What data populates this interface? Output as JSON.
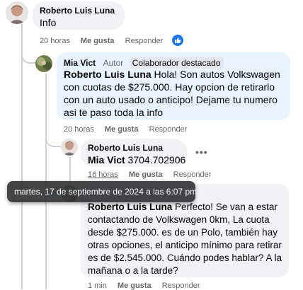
{
  "comments": [
    {
      "author": "Roberto Luis Luna",
      "text": "Info",
      "time": "20 horas",
      "like_label": "Me gusta",
      "reply_label": "Responder"
    },
    {
      "author": "Mia Vict",
      "author_badge": "Autor",
      "collab_badge": "Colaborador destacado",
      "mention": "Roberto Luis Luna",
      "text": " Hola! Son autos Volkswagen con cuotas de $275.000. Hay opcion de retirarlo con un auto usado o anticipo! Dejame tu numero asi te paso toda la info",
      "time": "20 horas",
      "like_label": "Me gusta",
      "reply_label": "Responder"
    },
    {
      "author": "Roberto Luis Luna",
      "mention": "Mia Vict",
      "text": " 3704.702906",
      "time": "16 horas",
      "like_label": "Me gusta",
      "reply_label": "Responder"
    },
    {
      "mention": "Roberto Luis Luna",
      "text": " Perfecto! Se van a estar contactando de Volkswagen 0km, La cuota desde $275.000. es de un Polo, también hay otras opciones, el anticipo mínimo para retirar es de $2.545.000. Cuándo podes hablar? A la mañana o a la tarde?",
      "time": "1 min",
      "like_label": "Me gusta",
      "reply_label": "Responder"
    }
  ],
  "tooltip": "martes, 17 de septiembre de 2024 a las 6:07 pm",
  "colors": {
    "accent": "#1877f2",
    "bubble": "#f0f2f5",
    "highlight": "#e7f3ff",
    "thread": "#ced0d4"
  },
  "icons": {
    "reaction": "thumbs-up-icon",
    "more": "more-options-icon"
  }
}
